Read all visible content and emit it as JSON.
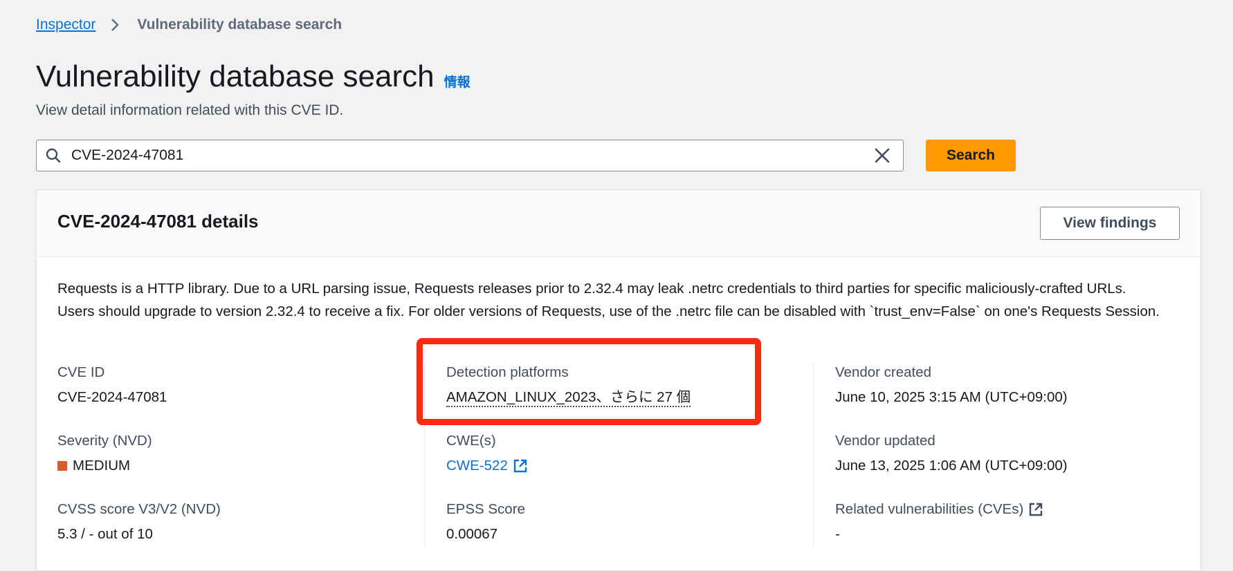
{
  "breadcrumb": {
    "parent": "Inspector",
    "current": "Vulnerability database search"
  },
  "header": {
    "title": "Vulnerability database search",
    "info_link": "情報",
    "subtitle": "View detail information related with this CVE ID."
  },
  "search": {
    "value": "CVE-2024-47081",
    "button_label": "Search"
  },
  "details": {
    "title": "CVE-2024-47081 details",
    "view_findings_label": "View findings",
    "description": "Requests is a HTTP library. Due to a URL parsing issue, Requests releases prior to 2.32.4 may leak .netrc credentials to third parties for specific maliciously-crafted URLs. Users should upgrade to version 2.32.4 to receive a fix. For older versions of Requests, use of the .netrc file can be disabled with `trust_env=False` on one's Requests Session.",
    "cve_id_label": "CVE ID",
    "cve_id": "CVE-2024-47081",
    "severity_label": "Severity (NVD)",
    "severity": "MEDIUM",
    "severity_color": "#d15f27",
    "cvss_label": "CVSS score V3/V2 (NVD)",
    "cvss": "5.3 / - out of 10",
    "platforms_label": "Detection platforms",
    "platforms": "AMAZON_LINUX_2023、さらに 27 個",
    "cwe_label": "CWE(s)",
    "cwe": "CWE-522",
    "epss_label": "EPSS Score",
    "epss": "0.00067",
    "vendor_created_label": "Vendor created",
    "vendor_created": "June 10, 2025 3:15 AM (UTC+09:00)",
    "vendor_updated_label": "Vendor updated",
    "vendor_updated": "June 13, 2025 1:06 AM (UTC+09:00)",
    "related_label": "Related vulnerabilities (CVEs)",
    "related": "-"
  },
  "colors": {
    "link": "#0972d3",
    "primary_button": "#ff9900",
    "highlight_box": "#ff2a12"
  },
  "icons": {
    "breadcrumb_separator": "chevron-right-icon",
    "search": "search-icon",
    "clear": "close-icon",
    "external": "external-link-icon"
  }
}
